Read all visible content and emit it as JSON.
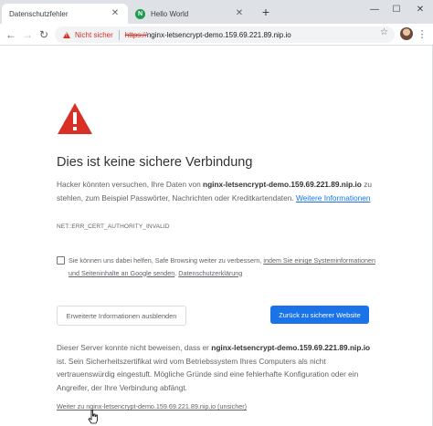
{
  "tabs": [
    {
      "label": "Datenschutzfehler",
      "active": true
    },
    {
      "label": "Hello World",
      "active": false,
      "favicon": "N"
    }
  ],
  "toolbar": {
    "security_label": "Nicht sicher",
    "url_scheme": "https://",
    "url_host": "nginx-letsencrypt-demo.159.69.221.89.nip.io"
  },
  "page": {
    "headline": "Dies ist keine sichere Verbindung",
    "intro_before": "Hacker könnten versuchen, Ihre Daten von ",
    "intro_host": "nginx-letsencrypt-demo.159.69.221.89.nip.io",
    "intro_after": " zu stehlen, zum Beispiel Passwörter, Nachrichten oder Kreditkartendaten. ",
    "learn_more": "Weitere Informationen",
    "error_code": "NET::ERR_CERT_AUTHORITY_INVALID",
    "checkbox_before": "Sie können uns dabei helfen, Safe Browsing weiter zu verbessern, ",
    "checkbox_link1": "indem Sie einige Systeminformationen und Seiteninhalte an Google senden",
    "checkbox_sep": ". ",
    "checkbox_link2": "Datenschutzerklärung",
    "hide_details_button": "Erweiterte Informationen ausblenden",
    "back_button": "Zurück zu sicherer Website",
    "details_before": "Dieser Server konnte nicht beweisen, dass er ",
    "details_host": "nginx-letsencrypt-demo.159.69.221.89.nip.io",
    "details_after": " ist. Sein Sicherheitszertifikat wird vom Betriebssystem Ihres Computers als nicht vertrauenswürdig eingestuft. Mögliche Gründe sind eine fehlerhafte Konfiguration oder ein Angreifer, der Ihre Verbindung abfängt.",
    "proceed_link": "Weiter zu nginx-letsencrypt-demo.159.69.221.89.nip.io (unsicher)"
  },
  "colors": {
    "warning_red": "#d93025",
    "link_blue": "#1a73e8",
    "tab_strip": "#dee1e6"
  },
  "icons": [
    "close-icon",
    "plus-icon",
    "minimize-icon",
    "maximize-icon",
    "back-arrow-icon",
    "forward-arrow-icon",
    "reload-icon",
    "warning-icon",
    "star-icon",
    "menu-dots-icon",
    "hand-cursor-icon"
  ]
}
